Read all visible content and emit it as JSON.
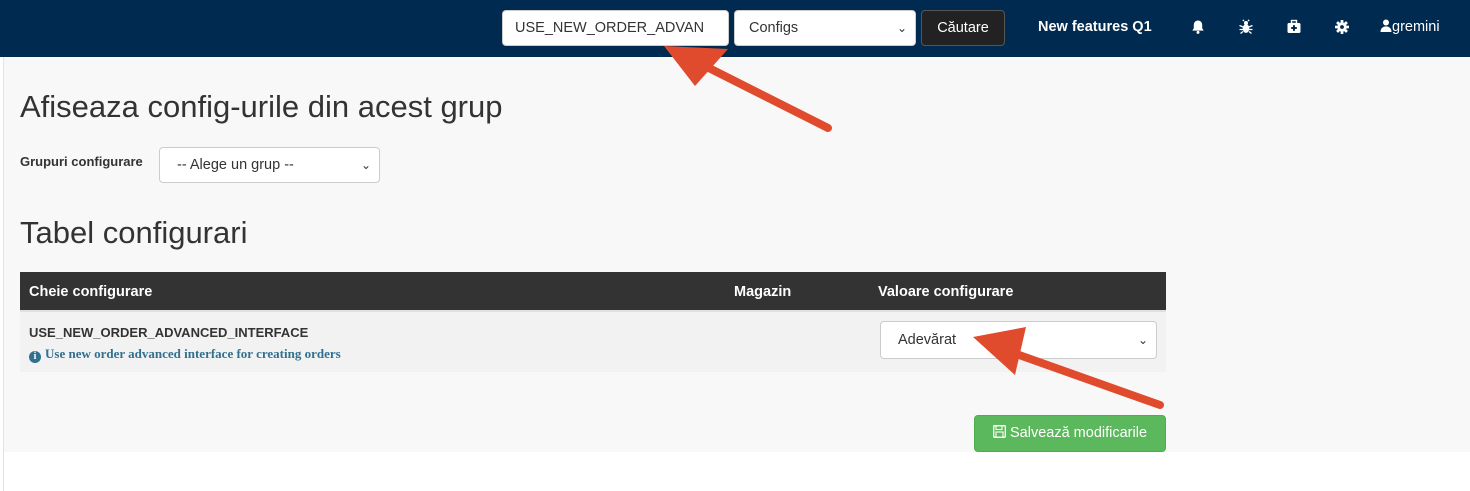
{
  "navbar": {
    "search_value": "USE_NEW_ORDER_ADVAN",
    "type_select": "Configs",
    "search_button": "Căutare",
    "features_link": "New features Q1",
    "username": "gremini",
    "icons": [
      "bell-icon",
      "bug-icon",
      "medkit-icon",
      "gear-icon",
      "user-icon"
    ]
  },
  "groups_section": {
    "title": "Afiseaza config-urile din acest grup",
    "label": "Grupuri configurare",
    "select_value": "-- Alege un grup --"
  },
  "table_section": {
    "title": "Tabel configurari",
    "columns": [
      "Cheie configurare",
      "Magazin",
      "Valoare configurare"
    ],
    "rows": [
      {
        "key": "USE_NEW_ORDER_ADVANCED_INTERFACE",
        "description": "Use new order advanced interface for creating orders",
        "store": "",
        "value": "Adevărat"
      }
    ]
  },
  "save_button": "Salvează modificarile",
  "colors": {
    "navbar": "#002a4f",
    "table_header": "#333333",
    "save": "#5cb85c",
    "annotation_arrow": "#e04b2d",
    "info": "#31708f"
  }
}
